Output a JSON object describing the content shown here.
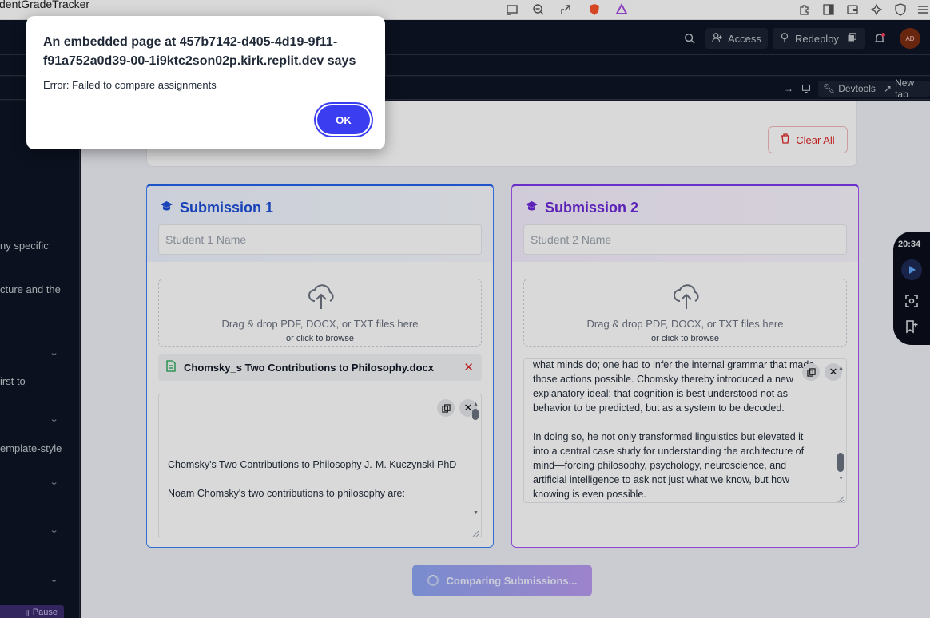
{
  "browser": {
    "tab_title": "dentGradeTracker"
  },
  "replit": {
    "access_label": "Access",
    "redeploy_label": "Redeploy",
    "avatar_initials": "AD",
    "devtools_label": "Devtools",
    "newtab_label": "New tab"
  },
  "sidebar": {
    "lines": [
      "ny specific",
      "cture and the",
      "irst to",
      "emplate-style"
    ],
    "pause_label": "Pause"
  },
  "app": {
    "clear_all_label": "Clear All",
    "submission1": {
      "title": "Submission 1",
      "name_placeholder": "Student 1 Name",
      "drop_main": "Drag & drop PDF, DOCX, or TXT files here",
      "drop_sub": "or click to browse",
      "file_name": "Chomsky_s Two Contributions to Philosophy.docx",
      "text_lines": [
        "Chomsky's Two Contributions to Philosophy J.-M. Kuczynski PhD",
        "",
        "Noam Chomsky's two contributions to philosophy are:"
      ]
    },
    "submission2": {
      "title": "Submission 2",
      "name_placeholder": "Student 2 Name",
      "drop_main": "Drag & drop PDF, DOCX, or TXT files here",
      "drop_sub": "or click to browse",
      "text_lines": [
        "what minds do; one had to infer the internal grammar that made",
        "those actions possible. Chomsky thereby introduced a new",
        "explanatory ideal: that cognition is best understood not as",
        "behavior to be predicted, but as a system to be decoded.",
        "",
        "In doing so, he not only transformed linguistics but elevated it",
        "into a central case study for understanding the architecture of",
        "mind—forcing philosophy, psychology, neuroscience, and",
        "artificial intelligence to ask not just what we know, but how",
        "knowing is even possible."
      ]
    },
    "compare_label": "Comparing Submissions..."
  },
  "recorder": {
    "time": "20:34"
  },
  "dialog": {
    "title": "An embedded page at 457b7142-d405-4d19-9f11-f91a752a0d39-00-1i9ktc2son02p.kirk.replit.dev says",
    "message": "Error: Failed to compare assignments",
    "ok_label": "OK"
  },
  "colors": {
    "accent_blue": "#2563eb",
    "accent_purple": "#7c3aed",
    "danger": "#dc2626",
    "dialog_button": "#3b3ef0"
  }
}
